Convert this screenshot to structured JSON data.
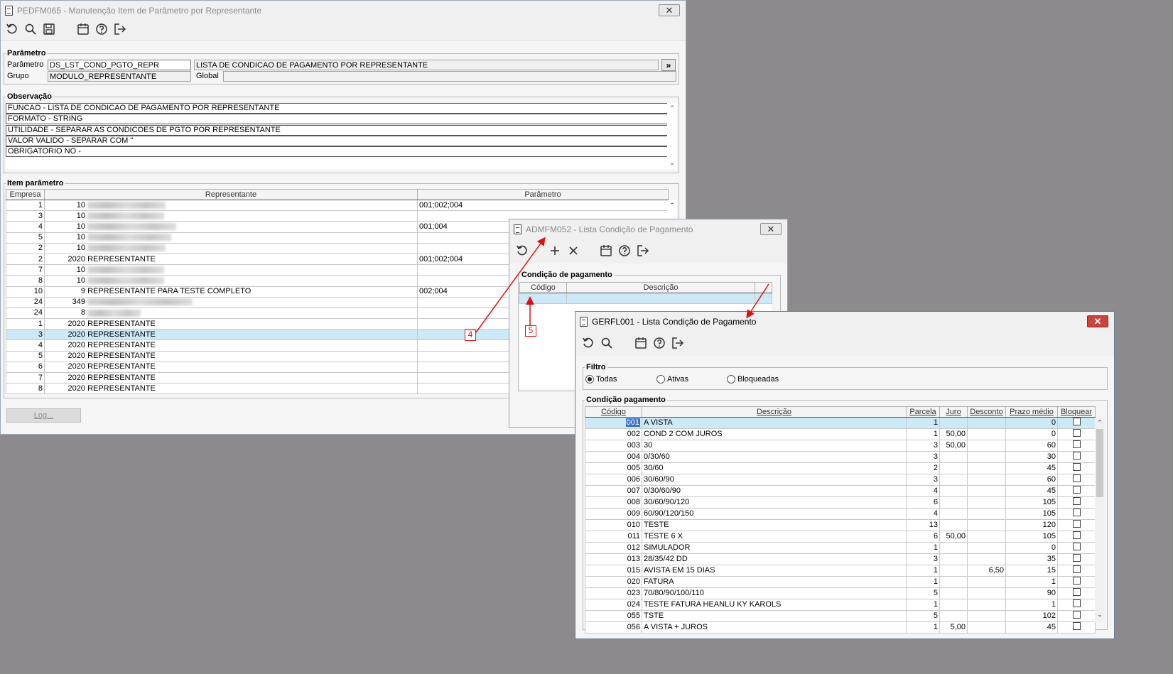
{
  "win1": {
    "title": "PEDFM065 - Manutenção Item de Parâmetro por Representante",
    "parametro_group": "Parâmetro",
    "parametro_label": "Parâmetro",
    "parametro_value": "DS_LST_COND_PGTO_REPR",
    "parametro_desc": "LISTA DE CONDICAO DE PAGAMENTO POR REPRESENTANTE",
    "grupo_label": "Grupo",
    "grupo_value": "MODULO_REPRESENTANTE",
    "global_label": "Global",
    "expand_btn": "»",
    "obs_group": "Observação",
    "obs_lines": [
      "FUNCAO - LISTA DE CONDICAO DE PAGAMENTO POR REPRESENTANTE",
      "FORMATO - STRING",
      "UTILIDADE - SEPARAR AS CONDICOES DE PGTO POR REPRESENTANTE",
      "VALOR VALIDO - SEPARAR COM \"",
      "OBRIGATORIO NO -"
    ],
    "item_group": "Item parâmetro",
    "columns": [
      "Empresa",
      "Representante",
      "Parâmetro"
    ],
    "rows": [
      {
        "empresa": "1",
        "rep_code": "10",
        "rep_name": "",
        "blur": 110,
        "param": "001;002;004"
      },
      {
        "empresa": "3",
        "rep_code": "10",
        "rep_name": "",
        "blur": 108,
        "param": ""
      },
      {
        "empresa": "4",
        "rep_code": "10",
        "rep_name": "",
        "blur": 125,
        "param": "001;004"
      },
      {
        "empresa": "5",
        "rep_code": "10",
        "rep_name": "",
        "blur": 118,
        "param": ""
      },
      {
        "empresa": "2",
        "rep_code": "10",
        "rep_name": "",
        "blur": 110,
        "param": ""
      },
      {
        "empresa": "2",
        "rep_code": "2020",
        "rep_name": "REPRESENTANTE",
        "blur": 0,
        "param": "001;002;004"
      },
      {
        "empresa": "7",
        "rep_code": "10",
        "rep_name": "",
        "blur": 108,
        "param": ""
      },
      {
        "empresa": "8",
        "rep_code": "10",
        "rep_name": "",
        "blur": 108,
        "param": ""
      },
      {
        "empresa": "10",
        "rep_code": "9",
        "rep_name": "REPRESENTANTE PARA TESTE COMPLETO",
        "blur": 0,
        "param": "002;004"
      },
      {
        "empresa": "24",
        "rep_code": "349",
        "rep_name": "",
        "blur": 148,
        "param": ""
      },
      {
        "empresa": "24",
        "rep_code": "8",
        "rep_name": "",
        "blur": 75,
        "param": ""
      },
      {
        "empresa": "1",
        "rep_code": "2020",
        "rep_name": "REPRESENTANTE",
        "blur": 0,
        "param": ""
      },
      {
        "empresa": "3",
        "rep_code": "2020",
        "rep_name": "REPRESENTANTE",
        "blur": 0,
        "param": "",
        "selected": true
      },
      {
        "empresa": "4",
        "rep_code": "2020",
        "rep_name": "REPRESENTANTE",
        "blur": 0,
        "param": ""
      },
      {
        "empresa": "5",
        "rep_code": "2020",
        "rep_name": "REPRESENTANTE",
        "blur": 0,
        "param": ""
      },
      {
        "empresa": "6",
        "rep_code": "2020",
        "rep_name": "REPRESENTANTE",
        "blur": 0,
        "param": ""
      },
      {
        "empresa": "7",
        "rep_code": "2020",
        "rep_name": "REPRESENTANTE",
        "blur": 0,
        "param": ""
      },
      {
        "empresa": "8",
        "rep_code": "2020",
        "rep_name": "REPRESENTANTE",
        "blur": 0,
        "param": ""
      }
    ],
    "log_button": "Log..."
  },
  "win2": {
    "title": "ADMFM052 - Lista Condição de Pagamento",
    "group": "Condição de pagamento",
    "columns": [
      "Código",
      "Descrição"
    ]
  },
  "win3": {
    "title": "GERFL001 - Lista Condição de Pagamento",
    "filtro_group": "Filtro",
    "filtro_options": [
      "Todas",
      "Ativas",
      "Bloqueadas"
    ],
    "filtro_selected": "Todas",
    "cond_group": "Condição pagamento",
    "columns": [
      "Código",
      "Descrição",
      "Parcela",
      "Juro",
      "Desconto",
      "Prazo médio",
      "Bloquear"
    ],
    "rows": [
      {
        "codigo": "001",
        "descricao": "A VISTA",
        "parcela": "1",
        "juro": "",
        "desconto": "",
        "prazo": "0",
        "bloquear": false
      },
      {
        "codigo": "002",
        "descricao": "COND 2 COM JUROS",
        "parcela": "1",
        "juro": "50,00",
        "desconto": "",
        "prazo": "0",
        "bloquear": false
      },
      {
        "codigo": "003",
        "descricao": "30",
        "parcela": "3",
        "juro": "50,00",
        "desconto": "",
        "prazo": "60",
        "bloquear": false
      },
      {
        "codigo": "004",
        "descricao": "0/30/60",
        "parcela": "3",
        "juro": "",
        "desconto": "",
        "prazo": "30",
        "bloquear": false
      },
      {
        "codigo": "005",
        "descricao": "30/60",
        "parcela": "2",
        "juro": "",
        "desconto": "",
        "prazo": "45",
        "bloquear": false
      },
      {
        "codigo": "006",
        "descricao": "30/60/90",
        "parcela": "3",
        "juro": "",
        "desconto": "",
        "prazo": "60",
        "bloquear": false
      },
      {
        "codigo": "007",
        "descricao": "0/30/60/90",
        "parcela": "4",
        "juro": "",
        "desconto": "",
        "prazo": "45",
        "bloquear": false
      },
      {
        "codigo": "008",
        "descricao": "30/60/90/120",
        "parcela": "6",
        "juro": "",
        "desconto": "",
        "prazo": "105",
        "bloquear": false
      },
      {
        "codigo": "009",
        "descricao": "60/90/120/150",
        "parcela": "4",
        "juro": "",
        "desconto": "",
        "prazo": "105",
        "bloquear": false
      },
      {
        "codigo": "010",
        "descricao": "TESTE",
        "parcela": "13",
        "juro": "",
        "desconto": "",
        "prazo": "120",
        "bloquear": false
      },
      {
        "codigo": "011",
        "descricao": " TESTE 6 X",
        "parcela": "6",
        "juro": "50,00",
        "desconto": "",
        "prazo": "105",
        "bloquear": false
      },
      {
        "codigo": "012",
        "descricao": "SIMULADOR",
        "parcela": "1",
        "juro": "",
        "desconto": "",
        "prazo": "0",
        "bloquear": false
      },
      {
        "codigo": "013",
        "descricao": "28/35/42 DD",
        "parcela": "3",
        "juro": "",
        "desconto": "",
        "prazo": "35",
        "bloquear": false
      },
      {
        "codigo": "015",
        "descricao": "AVISTA EM 15 DIAS",
        "parcela": "1",
        "juro": "",
        "desconto": "6,50",
        "prazo": "15",
        "bloquear": false
      },
      {
        "codigo": "020",
        "descricao": "FATURA",
        "parcela": "1",
        "juro": "",
        "desconto": "",
        "prazo": "1",
        "bloquear": false
      },
      {
        "codigo": "023",
        "descricao": "70/80/90/100/110",
        "parcela": "5",
        "juro": "",
        "desconto": "",
        "prazo": "90",
        "bloquear": false
      },
      {
        "codigo": "024",
        "descricao": "TESTE FATURA HEANLU KY KAROLS",
        "parcela": "1",
        "juro": "",
        "desconto": "",
        "prazo": "1",
        "bloquear": false
      },
      {
        "codigo": "055",
        "descricao": "TSTE",
        "parcela": "5",
        "juro": "",
        "desconto": "",
        "prazo": "102",
        "bloquear": false
      },
      {
        "codigo": "056",
        "descricao": "A VISTA + JUROS",
        "parcela": "1",
        "juro": "5,00",
        "desconto": "",
        "prazo": "45",
        "bloquear": false
      }
    ]
  },
  "annotations": {
    "callout_4": "4",
    "callout_5": "5"
  },
  "colors": {
    "selection": "#cde9f7",
    "arrow": "#dd1111",
    "desktop": "#8c8a8c"
  }
}
